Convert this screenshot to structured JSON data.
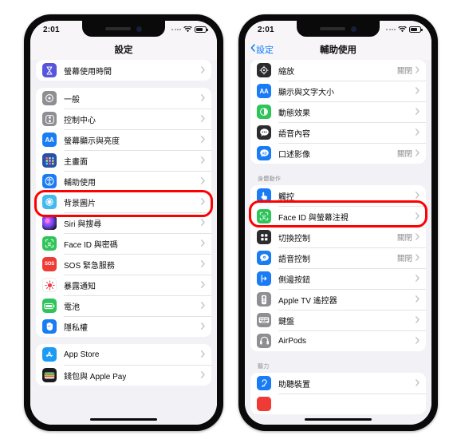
{
  "phones": [
    {
      "id": "settings-phone",
      "status_bar": {
        "time": "2:01",
        "wifi": "wifi-icon",
        "battery": "battery-icon",
        "signal": "signal-dots-icon"
      },
      "nav": {
        "title": "設定",
        "back_label": null
      },
      "highlight_row": "輔助使用",
      "sections": [
        {
          "header": null,
          "rows": [
            {
              "label": "螢幕使用時間",
              "icon": "hourglass-icon",
              "icon_bg": "#5755d9",
              "value": null
            }
          ]
        },
        {
          "header": null,
          "rows": [
            {
              "label": "一般",
              "icon": "gear-icon",
              "icon_bg": "#8e8e93",
              "value": null
            },
            {
              "label": "控制中心",
              "icon": "control-center-icon",
              "icon_bg": "#8e8e93",
              "value": null
            },
            {
              "label": "螢幕顯示與亮度",
              "icon": "display-brightness-icon",
              "icon_bg": "#1a7cf5",
              "value": null
            },
            {
              "label": "主畫面",
              "icon": "home-screen-icon",
              "icon_bg": "#2b4ea8",
              "value": null
            },
            {
              "label": "輔助使用",
              "icon": "accessibility-icon",
              "icon_bg": "#1a7cf5",
              "value": null
            },
            {
              "label": "背景圖片",
              "icon": "wallpaper-icon",
              "icon_bg": "#43b9f0",
              "value": null
            },
            {
              "label": "Siri 與搜尋",
              "icon": "siri-icon",
              "icon_bg": "#2a2a4a",
              "value": null
            },
            {
              "label": "Face ID 與密碼",
              "icon": "face-id-icon",
              "icon_bg": "#2fc45a",
              "value": null
            },
            {
              "label": "SOS 緊急服務",
              "icon": "sos-icon",
              "icon_bg": "#ef3b36",
              "value": null
            },
            {
              "label": "暴露通知",
              "icon": "exposure-notification-icon",
              "icon_bg": "#ffffff",
              "value": null
            },
            {
              "label": "電池",
              "icon": "battery-settings-icon",
              "icon_bg": "#2fc45a",
              "value": null
            },
            {
              "label": "隱私權",
              "icon": "privacy-hand-icon",
              "icon_bg": "#1a7cf5",
              "value": null
            }
          ]
        },
        {
          "header": null,
          "rows": [
            {
              "label": "App Store",
              "icon": "app-store-icon",
              "icon_bg": "#1a9bf5",
              "value": null
            },
            {
              "label": "錢包與 Apple Pay",
              "icon": "wallet-icon",
              "icon_bg": "#1c1c1e",
              "value": null
            }
          ]
        }
      ]
    },
    {
      "id": "accessibility-phone",
      "status_bar": {
        "time": "2:01",
        "wifi": "wifi-icon",
        "battery": "battery-icon",
        "signal": "signal-dots-icon"
      },
      "nav": {
        "title": "輔助使用",
        "back_label": "設定"
      },
      "highlight_row": "觸控",
      "sections": [
        {
          "header": null,
          "rows": [
            {
              "label": "縮放",
              "icon": "zoom-icon",
              "icon_bg": "#2c2c2e",
              "value": "關閉"
            },
            {
              "label": "顯示與文字大小",
              "icon": "display-text-size-icon",
              "icon_bg": "#1a7cf5",
              "value": null
            },
            {
              "label": "動態效果",
              "icon": "motion-icon",
              "icon_bg": "#2fc45a",
              "value": null
            },
            {
              "label": "語音內容",
              "icon": "spoken-content-icon",
              "icon_bg": "#2c2c2e",
              "value": null
            },
            {
              "label": "口述影像",
              "icon": "audio-description-icon",
              "icon_bg": "#1a7cf5",
              "value": "關閉"
            }
          ]
        },
        {
          "header": "身體動作",
          "rows": [
            {
              "label": "觸控",
              "icon": "touch-icon",
              "icon_bg": "#1a7cf5",
              "value": null
            },
            {
              "label": "Face ID 與螢幕注視",
              "icon": "face-id-attention-icon",
              "icon_bg": "#2fc45a",
              "value": null
            },
            {
              "label": "切換控制",
              "icon": "switch-control-icon",
              "icon_bg": "#2c2c2e",
              "value": "關閉"
            },
            {
              "label": "語音控制",
              "icon": "voice-control-icon",
              "icon_bg": "#1a7cf5",
              "value": "關閉"
            },
            {
              "label": "側邊按鈕",
              "icon": "side-button-icon",
              "icon_bg": "#1a7cf5",
              "value": null
            },
            {
              "label": "Apple TV 遙控器",
              "icon": "apple-tv-remote-icon",
              "icon_bg": "#8e8e93",
              "value": null
            },
            {
              "label": "鍵盤",
              "icon": "keyboard-icon",
              "icon_bg": "#8e8e93",
              "value": null
            },
            {
              "label": "AirPods",
              "icon": "airpods-icon",
              "icon_bg": "#8e8e93",
              "value": null
            }
          ]
        },
        {
          "header": "聽力",
          "rows": [
            {
              "label": "助聽裝置",
              "icon": "hearing-devices-icon",
              "icon_bg": "#1a7cf5",
              "value": null
            },
            {
              "label": "",
              "icon": "sound-recognition-icon",
              "icon_bg": "#ef3b36",
              "value": null
            }
          ]
        }
      ]
    }
  ],
  "colors": {
    "highlight": "#ff0000",
    "accent": "#0a7cff",
    "screen_bg": "#f2f1f6"
  }
}
